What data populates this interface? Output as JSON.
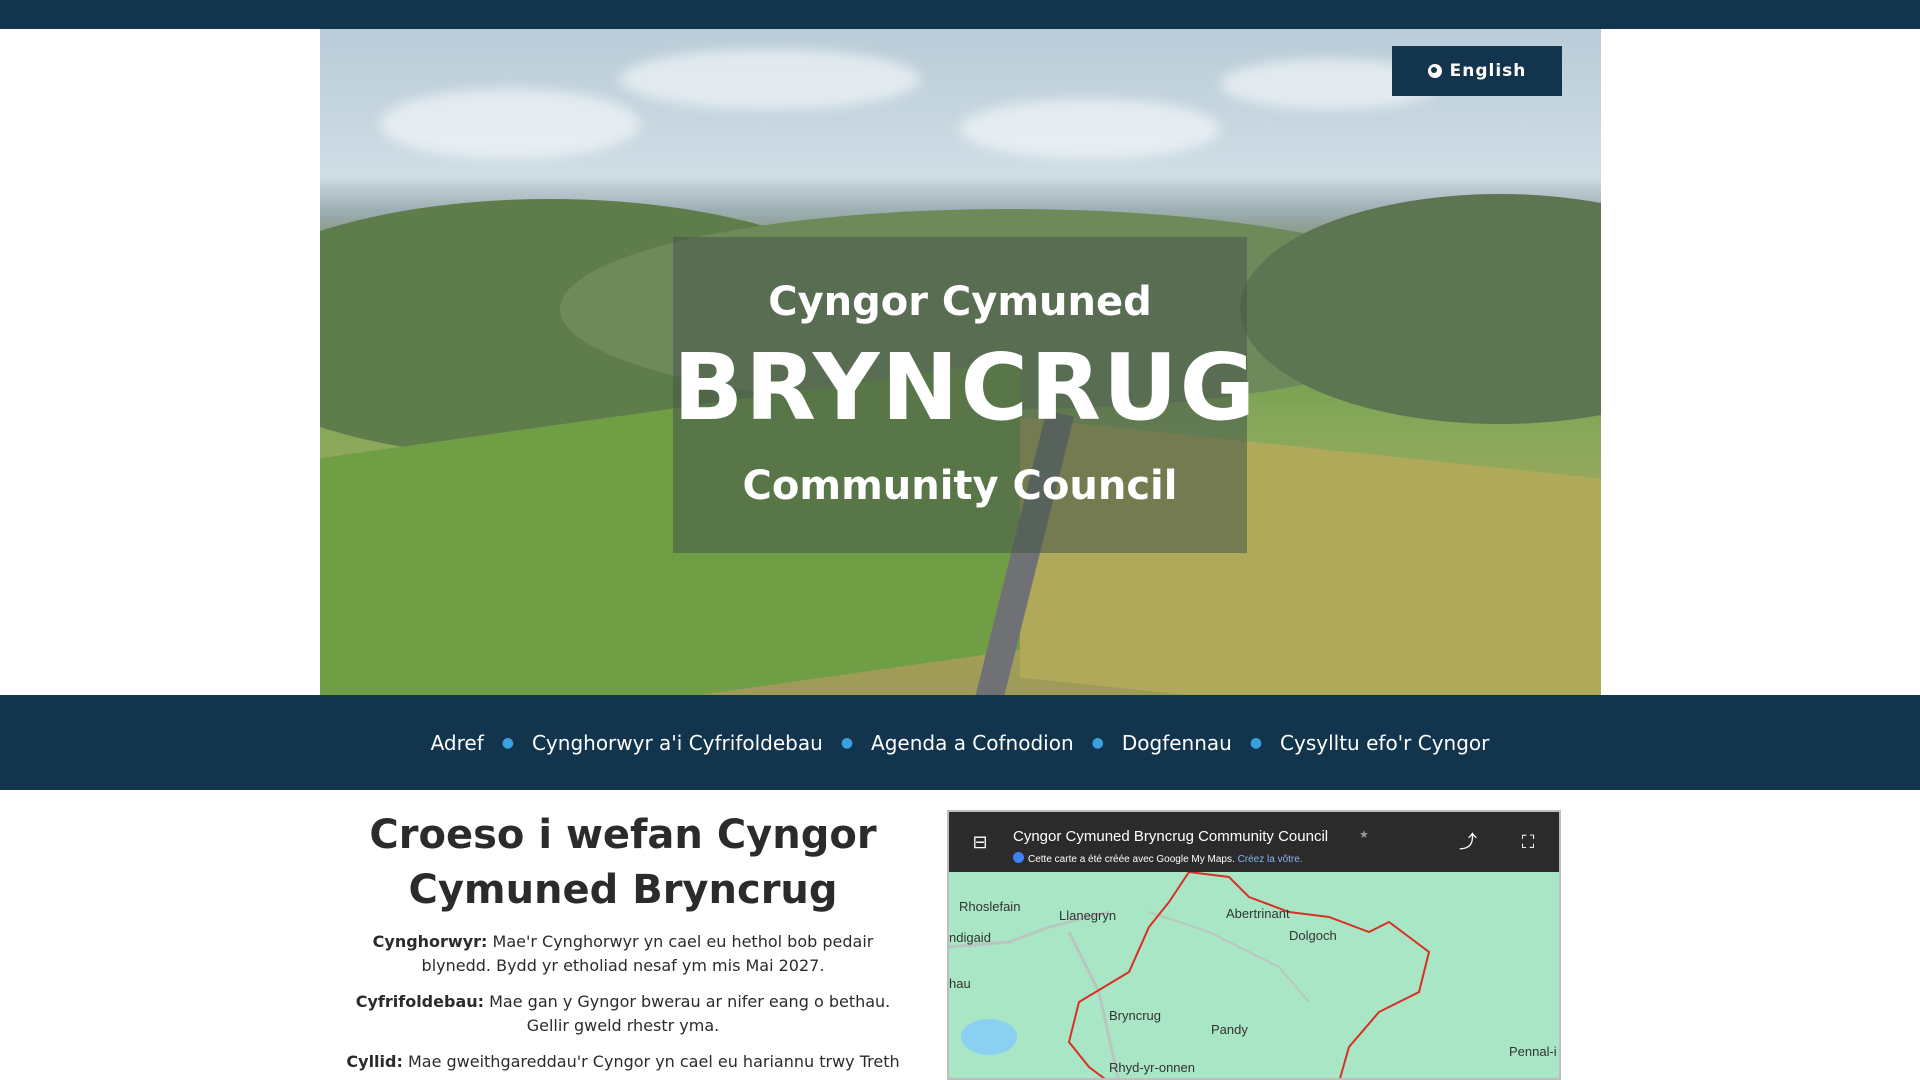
{
  "header": {
    "lang_button": "English"
  },
  "hero": {
    "line1": "Cyngor Cymuned",
    "line2": "BRYNCRUG",
    "line3": "Community Council"
  },
  "nav": {
    "items": [
      {
        "label": "Adref"
      },
      {
        "label": "Cynghorwyr a'i Cyfrifoldebau"
      },
      {
        "label": "Agenda a Cofnodion"
      },
      {
        "label": "Dogfennau"
      },
      {
        "label": "Cysylltu efo'r Cyngor"
      }
    ]
  },
  "main": {
    "heading": "Croeso i wefan Cyngor Cymuned Bryncrug",
    "paragraphs": [
      {
        "label": "Cynghorwyr:",
        "text": " Mae'r Cynghorwyr yn cael eu hethol bob pedair blynedd. Bydd yr etholiad nesaf ym mis Mai 2027."
      },
      {
        "label": "Cyfrifoldebau:",
        "text": " Mae gan y Gyngor bwerau ar nifer eang o bethau. Gellir gweld rhestr yma."
      },
      {
        "label": "Cyllid:",
        "text": " Mae gweithgareddau'r Cyngor yn cael eu hariannu trwy Treth"
      }
    ]
  },
  "map": {
    "title": "Cyngor Cymuned Bryncrug Community Council",
    "note": "Cette carte a été créée avec Google My Maps.",
    "note_link": "Créez la vôtre.",
    "places": [
      "Rhoslefain",
      "Llanegryn",
      "Abertrinant",
      "Dolgoch",
      "ndigaid",
      "hau",
      "Bryncrug",
      "Pandy",
      "Pennal-i",
      "Rhyd-yr-onnen"
    ]
  },
  "colors": {
    "navy": "#12344d",
    "accent_dot": "#3aa0e0",
    "boundary": "#d93025"
  }
}
